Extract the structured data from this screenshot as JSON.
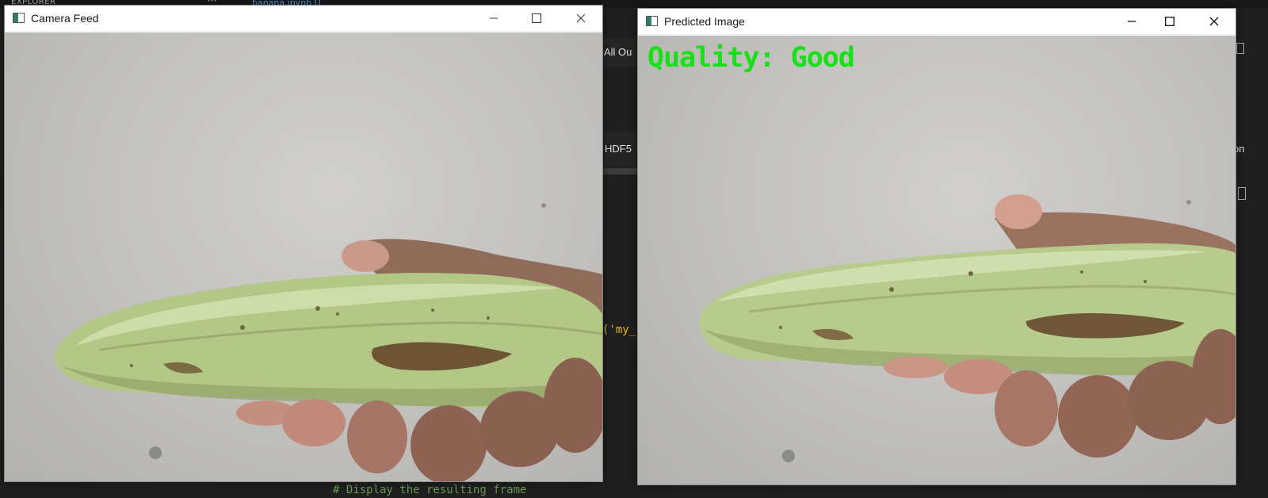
{
  "background_ide": {
    "explorer_label": "EXPLORER",
    "open_tab": "banana.ipynb U",
    "toolbar_all_outputs": "All Ou",
    "toolbar_hdf5": "HDF5",
    "code_fragment": "('my_",
    "code_comment": "# Display the resulting frame",
    "right_edge_fragment": "on"
  },
  "camera_window": {
    "title": "Camera Feed",
    "icon": "app-window-icon"
  },
  "predicted_window": {
    "title": "Predicted Image",
    "icon": "app-window-icon",
    "overlay_text": "Quality: Good"
  },
  "colors": {
    "overlay_text": "#18e018",
    "ide_background": "#1f1f1f",
    "titlebar": "#ffffff"
  }
}
